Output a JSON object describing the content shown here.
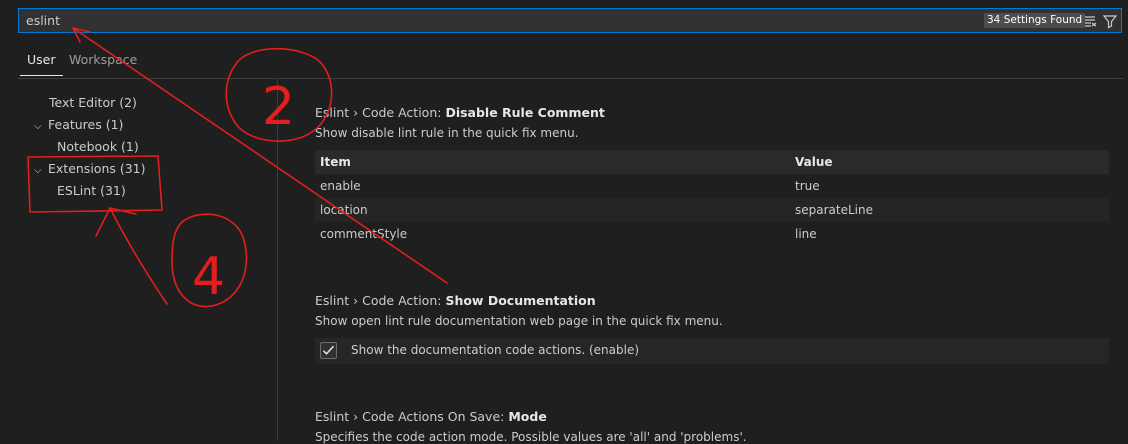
{
  "search": {
    "value": "eslint",
    "count_label": "34 Settings Found",
    "clear_filter_icon": "clear-filter-icon",
    "filter_icon": "filter-icon"
  },
  "tabs": [
    {
      "label": "User",
      "active": true
    },
    {
      "label": "Workspace",
      "active": false
    }
  ],
  "toc": [
    {
      "label": "Text Editor (2)",
      "expanded": null
    },
    {
      "label": "Features (1)",
      "expanded": true
    },
    {
      "label": "Notebook (1)",
      "expanded": null
    },
    {
      "label": "Extensions (31)",
      "expanded": true
    },
    {
      "label": "ESLint (31)",
      "expanded": null
    }
  ],
  "chevron_glyph": "⌵",
  "settings": {
    "disable_rule": {
      "category": "Eslint › Code Action: ",
      "name": "Disable Rule Comment",
      "description": "Show disable lint rule in the quick fix menu.",
      "table": {
        "headers": [
          "Item",
          "Value"
        ],
        "rows": [
          [
            "enable",
            "true"
          ],
          [
            "location",
            "separateLine"
          ],
          [
            "commentStyle",
            "line"
          ]
        ]
      }
    },
    "show_docs": {
      "category": "Eslint › Code Action: ",
      "name": "Show Documentation",
      "description": "Show open lint rule documentation web page in the quick fix menu.",
      "checkbox_label": "Show the documentation code actions. (enable)",
      "checked": true
    },
    "on_save_mode": {
      "category": "Eslint › Code Actions On Save: ",
      "name": "Mode",
      "description": "Specifies the code action mode. Possible values are 'all' and 'problems'."
    }
  },
  "annotations": {
    "step_2": "2",
    "step_4": "4",
    "color": "#e21e1e"
  },
  "colors": {
    "accent": "#0078d4",
    "background": "#1f1f1f",
    "badge": "#4d4d4d"
  }
}
